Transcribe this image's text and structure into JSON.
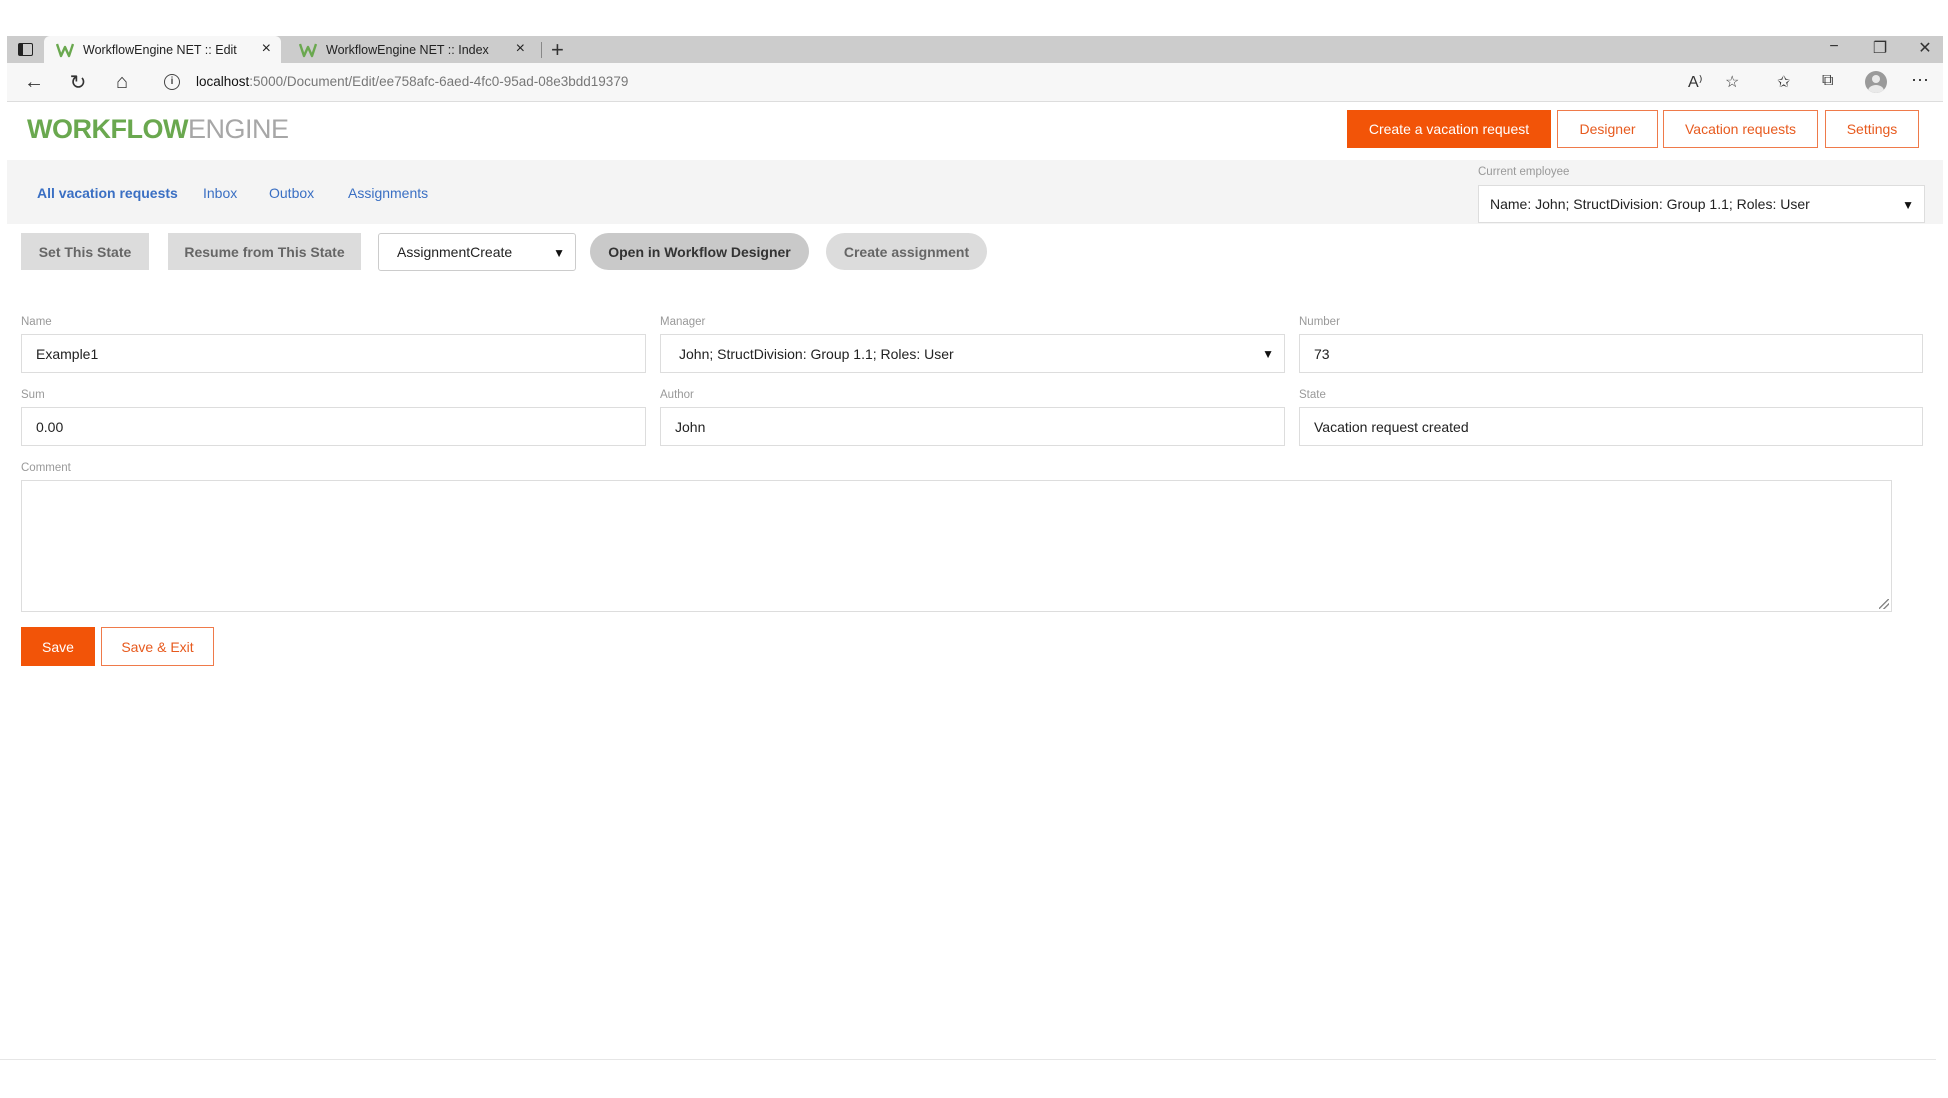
{
  "browser": {
    "tabs": [
      {
        "title": "WorkflowEngine NET :: Edit",
        "active": true
      },
      {
        "title": "WorkflowEngine NET :: Index",
        "active": false
      }
    ],
    "address": {
      "host": "localhost",
      "path": ":5000/Document/Edit/ee758afc-6aed-4fc0-95ad-08e3bdd19379"
    },
    "icons": {
      "tab_menu": "tab-actions-icon",
      "close": "×",
      "new_tab": "+",
      "minimize": "−",
      "restore": "❐",
      "window_close": "✕",
      "back": "←",
      "reload": "↻",
      "home": "⌂",
      "read_aloud": "A⁾",
      "favorite_add": "☆",
      "favorites": "✩",
      "collections": "⧉",
      "more": "⋯"
    }
  },
  "header": {
    "logo": {
      "part1": "WORKFLOW",
      "part2": "ENGINE"
    },
    "buttons": {
      "create": "Create a vacation request",
      "designer": "Designer",
      "vacation_requests": "Vacation requests",
      "settings": "Settings"
    }
  },
  "subnav": {
    "links": [
      "All vacation requests",
      "Inbox",
      "Outbox",
      "Assignments"
    ],
    "employee_label": "Current employee",
    "employee_value": "Name: John; StructDivision: Group 1.1; Roles: User"
  },
  "actions": {
    "set_state": "Set This State",
    "resume_state": "Resume from This State",
    "state_select": "AssignmentCreate",
    "open_designer": "Open in Workflow Designer",
    "create_assignment": "Create assignment"
  },
  "form": {
    "name": {
      "label": "Name",
      "value": "Example1"
    },
    "manager": {
      "label": "Manager",
      "value": "John; StructDivision: Group 1.1; Roles: User"
    },
    "number": {
      "label": "Number",
      "value": "73"
    },
    "sum": {
      "label": "Sum",
      "value": "0.00"
    },
    "author": {
      "label": "Author",
      "value": "John"
    },
    "state": {
      "label": "State",
      "value": "Vacation request created"
    },
    "comment": {
      "label": "Comment",
      "value": ""
    }
  },
  "footer_buttons": {
    "save": "Save",
    "save_exit": "Save & Exit"
  },
  "colors": {
    "accent": "#f25408",
    "link": "#3a6fc3",
    "logo_green": "#6aa84f"
  }
}
